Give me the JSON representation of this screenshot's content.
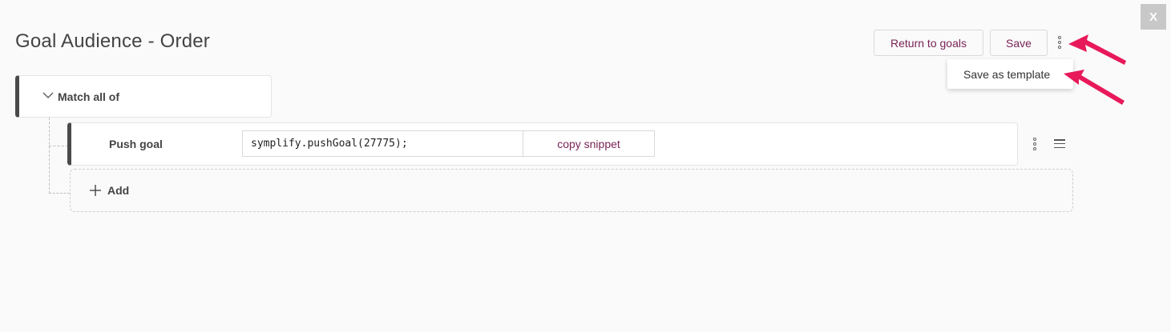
{
  "window": {
    "close_label": "X"
  },
  "header": {
    "title": "Goal Audience - Order",
    "return_label": "Return to goals",
    "save_label": "Save",
    "more_icon": "more-vertical-icon"
  },
  "menu": {
    "items": [
      {
        "label": "Save as template"
      }
    ]
  },
  "match": {
    "label": "Match all of",
    "icon": "chevron-down-icon"
  },
  "rule": {
    "label": "Push goal",
    "snippet_value": "symplify.pushGoal(27775);",
    "copy_label": "copy snippet",
    "more_icon": "more-vertical-icon",
    "drag_icon": "drag-handle-icon"
  },
  "add": {
    "label": "Add",
    "icon": "plus-icon"
  },
  "colors": {
    "accent": "#7a2456",
    "annotation_arrow": "#e8195a",
    "border_accent": "#4a4a4a",
    "background": "#fafafa"
  }
}
